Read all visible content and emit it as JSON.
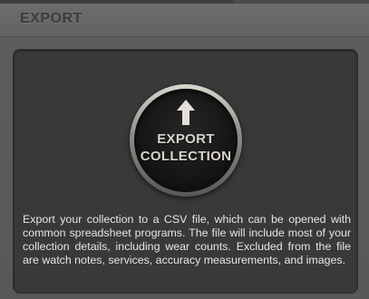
{
  "header": {
    "title": "EXPORT"
  },
  "export_button": {
    "line1": "EXPORT",
    "line2": "COLLECTION",
    "icon": "arrow-up-icon"
  },
  "description": "Export your collection to a CSV file, which can be opened with common spreadsheet programs. The file will include most of your collection details, including wear counts. Excluded from the file are watch notes, services, accuracy measurements, and images.",
  "colors": {
    "panel": "#393939",
    "header": "#666666",
    "button_label": "#d8d4cc"
  }
}
